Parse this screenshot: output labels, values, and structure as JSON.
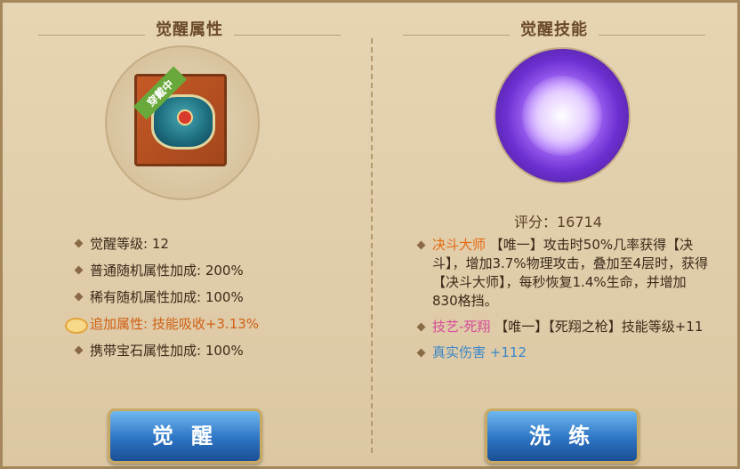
{
  "left_panel": {
    "title": "觉醒属性",
    "item_badge": "穿戴中",
    "stats": [
      {
        "label": "觉醒等级: 12"
      },
      {
        "label": "普通随机属性加成: 200%"
      },
      {
        "label": "稀有随机属性加成: 100%"
      },
      {
        "label": "追加属性: 技能吸收+3.13%"
      },
      {
        "label": "携带宝石属性加成: 100%"
      }
    ],
    "button": "觉 醒"
  },
  "right_panel": {
    "title": "觉醒技能",
    "score": "评分：16714",
    "skills": [
      {
        "name": "决斗大师",
        "desc": "【唯一】攻击时50%几率获得【决斗】，增加3.7%物理攻击，叠加至4层时，获得【决斗大师】，每秒恢复1.4%生命，并增加830格挡。"
      },
      {
        "name": "技艺-死翔",
        "desc": "【唯一】【死翔之枪】技能等级+11"
      },
      {
        "name": "真实伤害",
        "desc": "+112"
      }
    ],
    "button": "洗 练"
  },
  "colors": {
    "accent": "#2d74c4",
    "highlight": "#d06014"
  }
}
